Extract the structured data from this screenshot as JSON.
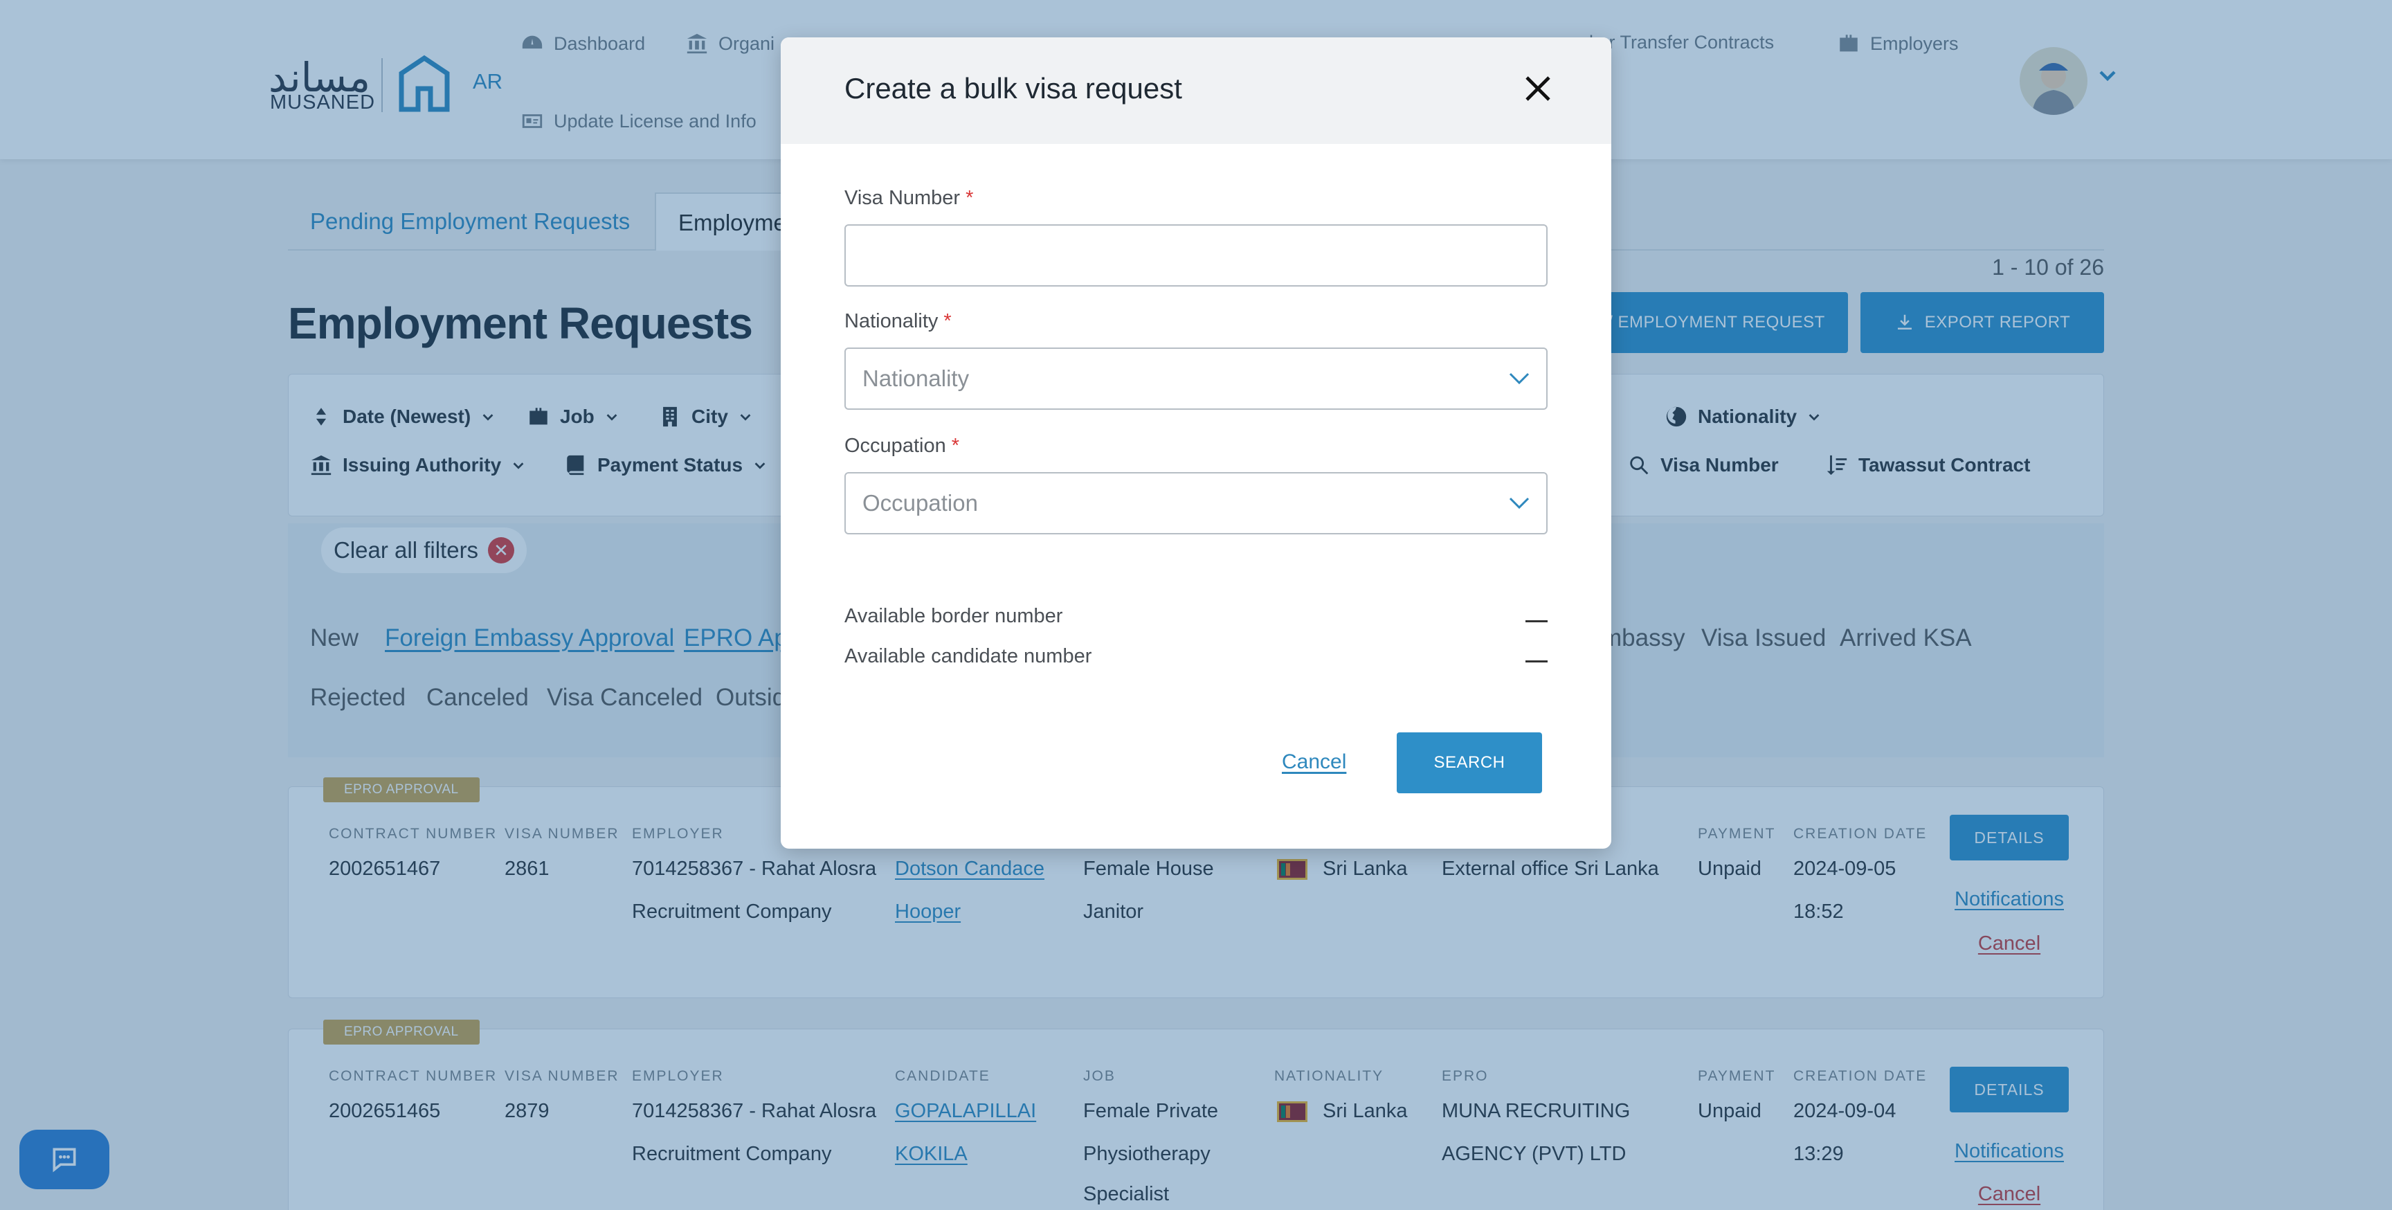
{
  "header": {
    "logo_ar": "مساند",
    "logo_en": "MUSANED",
    "lang": "AR",
    "nav": [
      {
        "label": "Dashboard",
        "icon": "dashboard-icon"
      },
      {
        "label": "Organi",
        "icon": "building-columns-icon"
      },
      {
        "label": "ker Transfer Contracts",
        "icon": "document-icon"
      },
      {
        "label": "Employers",
        "icon": "briefcase-icon"
      },
      {
        "label": "Update License and Info",
        "icon": "id-card-icon"
      }
    ]
  },
  "tabs": [
    {
      "label": "Pending Employment Requests"
    },
    {
      "label": "Employme"
    }
  ],
  "pagination": "1 - 10 of 26",
  "page_title": "Employment Requests",
  "actions": {
    "new_request": "/ EMPLOYMENT REQUEST",
    "export": "EXPORT REPORT"
  },
  "filters": [
    {
      "label": "Date (Newest)",
      "icon": "sort-icon"
    },
    {
      "label": "Job",
      "icon": "briefcase-icon"
    },
    {
      "label": "City",
      "icon": "building-icon"
    },
    {
      "label": "Nationality",
      "icon": "globe-icon"
    },
    {
      "label": "Issuing Authority",
      "icon": "bank-icon"
    },
    {
      "label": "Payment Status",
      "icon": "book-icon"
    },
    {
      "label": "Visa Number",
      "icon": "search-icon"
    },
    {
      "label": "Tawassut Contract",
      "icon": "sort-list-icon"
    }
  ],
  "clear_filters": "Clear all filters",
  "statuses": {
    "row1": [
      "New",
      "Foreign Embassy Approval",
      "EPRO Appr",
      "mbassy",
      "Visa Issued",
      "Arrived KSA"
    ],
    "row2": [
      "Rejected",
      "Canceled",
      "Visa Canceled",
      "Outsid"
    ]
  },
  "columns": {
    "contract_number": "CONTRACT NUMBER",
    "visa_number": "VISA NUMBER",
    "employer": "EMPLOYER",
    "candidate": "CANDIDATE",
    "job": "JOB",
    "nationality": "NATIONALITY",
    "epro": "EPRO",
    "payment": "PAYMENT",
    "creation_date": "CREATION DATE"
  },
  "records": [
    {
      "tag": "EPRO APPROVAL",
      "contract_number": "2002651467",
      "visa_number": "2861",
      "employer_line1": "7014258367 - Rahat Alosra",
      "employer_line2": "Recruitment Company",
      "candidate_line1": "Dotson Candace",
      "candidate_line2": "Hooper",
      "job_line1": "Female House",
      "job_line2": "Janitor",
      "job_line3": "",
      "nationality": "Sri Lanka",
      "epro_line1": "External office Sri Lanka",
      "epro_line2": "",
      "payment": "Unpaid",
      "date": "2024-09-05",
      "time": "18:52",
      "details": "DETAILS",
      "notifications": "Notifications",
      "cancel": "Cancel"
    },
    {
      "tag": "EPRO APPROVAL",
      "contract_number": "2002651465",
      "visa_number": "2879",
      "employer_line1": "7014258367 - Rahat Alosra",
      "employer_line2": "Recruitment Company",
      "candidate_line1": "GOPALAPILLAI",
      "candidate_line2": "KOKILA",
      "job_line1": "Female Private",
      "job_line2": "Physiotherapy",
      "job_line3": "Specialist",
      "nationality": "Sri Lanka",
      "epro_line1": "MUNA RECRUITING",
      "epro_line2": "AGENCY (PVT) LTD",
      "payment": "Unpaid",
      "date": "2024-09-04",
      "time": "13:29",
      "details": "DETAILS",
      "notifications": "Notifications",
      "cancel": "Cancel"
    }
  ],
  "modal": {
    "title": "Create a bulk visa request",
    "visa_number_label": "Visa Number",
    "visa_number_value": "",
    "nationality_label": "Nationality",
    "nationality_placeholder": "Nationality",
    "occupation_label": "Occupation",
    "occupation_placeholder": "Occupation",
    "required_mark": "*",
    "available_border_label": "Available border number",
    "available_border_value": "—",
    "available_candidate_label": "Available candidate number",
    "available_candidate_value": "—",
    "cancel": "Cancel",
    "search": "SEARCH"
  },
  "colors": {
    "primary": "#2e8fc8",
    "link": "#2e88bd",
    "tag": "#c8a24e",
    "danger": "#d93737",
    "overlay": "rgba(31,95,150,0.38)"
  }
}
